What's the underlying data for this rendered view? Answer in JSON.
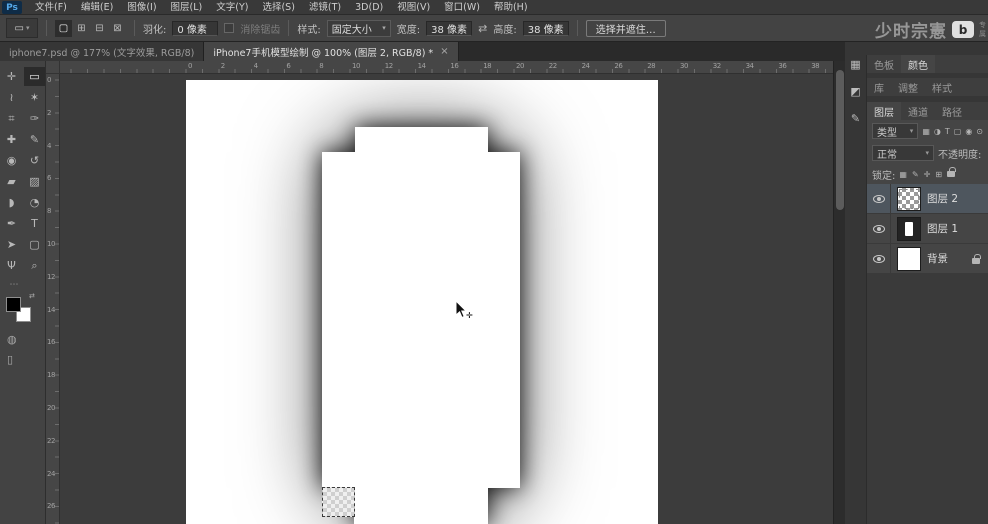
{
  "window": {
    "logo": "Ps"
  },
  "menubar": {
    "items": [
      "文件(F)",
      "编辑(E)",
      "图像(I)",
      "图层(L)",
      "文字(Y)",
      "选择(S)",
      "滤镜(T)",
      "3D(D)",
      "视图(V)",
      "窗口(W)",
      "帮助(H)"
    ]
  },
  "options": {
    "preset_icon": "▭",
    "caret": "▾",
    "selection_modes": [
      {
        "name": "new-selection-button",
        "glyph": "▢",
        "active": true
      },
      {
        "name": "add-selection-button",
        "glyph": "⊞",
        "active": false
      },
      {
        "name": "subtract-selection-button",
        "glyph": "⊟",
        "active": false
      },
      {
        "name": "intersect-selection-button",
        "glyph": "⊠",
        "active": false
      }
    ],
    "feather_label": "羽化:",
    "feather_value": "0 像素",
    "antialias_label": "消除锯齿",
    "style_label": "样式:",
    "style_value": "固定大小",
    "width_label": "宽度:",
    "width_value": "38 像素",
    "swap_icon": "⇄",
    "height_label": "高度:",
    "height_value": "38 像素",
    "select_mask_button": "选择并遮住…"
  },
  "tabs": [
    {
      "label": "iphone7.psd @ 177% (文字效果, RGB/8)",
      "active": false,
      "close": "×"
    },
    {
      "label": "iPhone7手机模型绘制 @ 100% (图层 2, RGB/8) *",
      "active": true,
      "close": "×"
    }
  ],
  "tools": [
    {
      "name": "move-tool",
      "glyph": "✛",
      "active": false
    },
    {
      "name": "rect-marquee-tool",
      "glyph": "▭",
      "active": true
    },
    {
      "name": "lasso-tool",
      "glyph": "≀",
      "active": false
    },
    {
      "name": "quick-selection-tool",
      "glyph": "✶",
      "active": false
    },
    {
      "name": "crop-tool",
      "glyph": "⌗",
      "active": false
    },
    {
      "name": "eyedropper-tool",
      "glyph": "✑",
      "active": false
    },
    {
      "name": "healing-brush-tool",
      "glyph": "✚",
      "active": false
    },
    {
      "name": "brush-tool",
      "glyph": "✎",
      "active": false
    },
    {
      "name": "clone-stamp-tool",
      "glyph": "◉",
      "active": false
    },
    {
      "name": "history-brush-tool",
      "glyph": "↺",
      "active": false
    },
    {
      "name": "eraser-tool",
      "glyph": "▰",
      "active": false
    },
    {
      "name": "gradient-tool",
      "glyph": "▨",
      "active": false
    },
    {
      "name": "blur-tool",
      "glyph": "◗",
      "active": false
    },
    {
      "name": "dodge-tool",
      "glyph": "◔",
      "active": false
    },
    {
      "name": "pen-tool",
      "glyph": "✒",
      "active": false
    },
    {
      "name": "type-tool",
      "glyph": "T",
      "active": false
    },
    {
      "name": "path-selection-tool",
      "glyph": "➤",
      "active": false
    },
    {
      "name": "shape-tool",
      "glyph": "▢",
      "active": false
    },
    {
      "name": "hand-tool",
      "glyph": "Ψ",
      "active": false
    },
    {
      "name": "zoom-tool",
      "glyph": "⌕",
      "active": false
    }
  ],
  "tools_extra": {
    "more_icon": "⋯",
    "swap_colors_icon": "⇄",
    "quick_mask_icon": "◍",
    "screen_mode_icon": "▯"
  },
  "rulers": {
    "h_numbers": [
      0,
      2,
      4,
      6,
      8,
      10,
      12,
      14,
      16,
      18,
      20,
      22,
      24,
      26,
      28,
      30,
      32,
      34,
      36,
      38
    ],
    "v_numbers": [
      0,
      2,
      4,
      6,
      8,
      10,
      12,
      14,
      16,
      18,
      20,
      22,
      24,
      26
    ]
  },
  "watermark": {
    "name": "少时宗憲",
    "logo_letter": "b",
    "side_text": [
      "专",
      "属"
    ]
  },
  "panels": {
    "side_icons": [
      {
        "name": "swatches-panel-icon",
        "glyph": "▦"
      },
      {
        "name": "adjustments-panel-icon",
        "glyph": "◩"
      },
      {
        "name": "brushes-panel-icon",
        "glyph": "✎"
      }
    ],
    "tab_groups": [
      [
        {
          "label": "色板",
          "active": false
        },
        {
          "label": "颜色",
          "active": true
        }
      ],
      [
        {
          "label": "库",
          "active": false
        },
        {
          "label": "调整",
          "active": false
        },
        {
          "label": "样式",
          "active": false
        }
      ],
      [
        {
          "label": "图层",
          "active": true
        },
        {
          "label": "通道",
          "active": false
        },
        {
          "label": "路径",
          "active": false
        }
      ]
    ],
    "layers_panel": {
      "filter_label": "类型",
      "filter_icons": [
        {
          "name": "pixel-filter-icon",
          "glyph": "▦"
        },
        {
          "name": "adjustment-filter-icon",
          "glyph": "◑"
        },
        {
          "name": "type-filter-icon",
          "glyph": "T"
        },
        {
          "name": "shape-filter-icon",
          "glyph": "▢"
        },
        {
          "name": "smart-object-filter-icon",
          "glyph": "◉"
        }
      ],
      "filter_toggle_icon": "⊙",
      "blend_mode": "正常",
      "opacity_label": "不透明度:",
      "lock_label": "锁定:",
      "lock_icons": [
        {
          "name": "lock-transparency-icon",
          "glyph": "▦"
        },
        {
          "name": "lock-pixels-icon",
          "glyph": "✎"
        },
        {
          "name": "lock-position-icon",
          "glyph": "✛"
        },
        {
          "name": "lock-artboard-icon",
          "glyph": "⊞"
        },
        {
          "name": "lock-all-icon",
          "glyph": "css-lock"
        }
      ],
      "layers": [
        {
          "name": "图层 2",
          "selected": true,
          "thumb": "checker",
          "locked": false
        },
        {
          "name": "图层 1",
          "selected": false,
          "thumb": "phone",
          "locked": false
        },
        {
          "name": "背景",
          "selected": false,
          "thumb": "white",
          "locked": true
        }
      ]
    }
  },
  "theme": {
    "app_bg": "#3c3c3c",
    "panel_bg": "#454545",
    "accent": "#53a7e8"
  }
}
